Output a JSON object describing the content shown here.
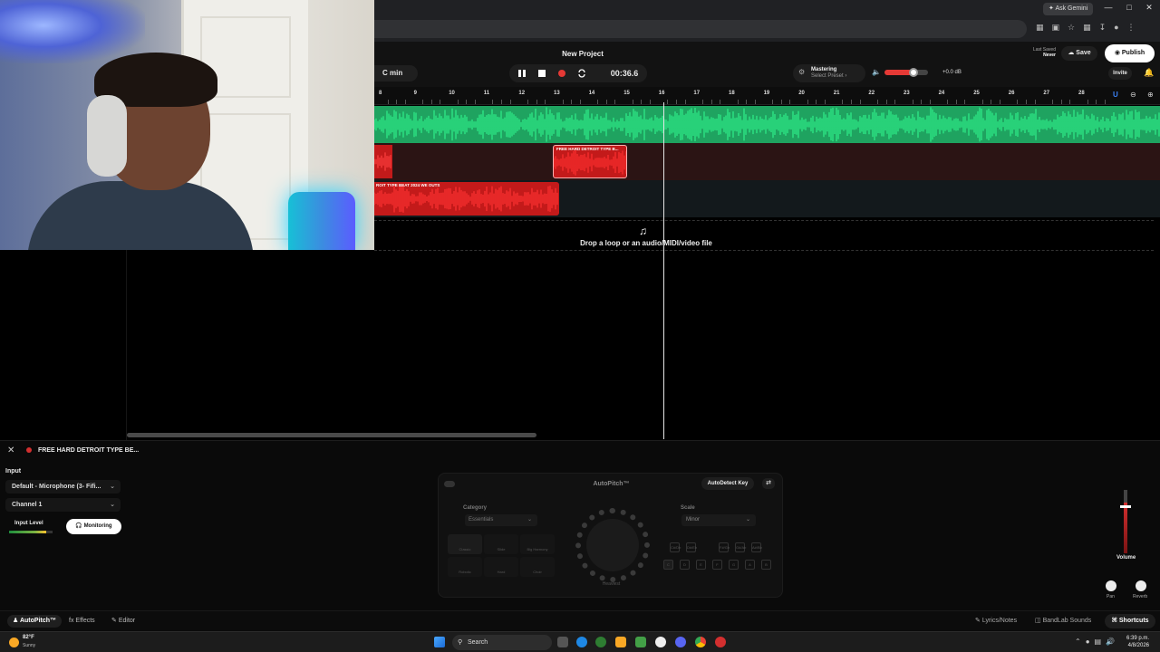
{
  "browser": {
    "ask_gemini": "Ask Gemini",
    "window_controls": [
      "—",
      "□",
      "✕"
    ]
  },
  "daw": {
    "project_title": "New Project",
    "key": "C min",
    "time": "00:36.6",
    "mastering_title": "Mastering",
    "mastering_preset": "Select Preset ›",
    "master_volume": 0.68,
    "volume_db": "+0.0 dB",
    "last_saved_label": "Last Saved",
    "last_saved_value": "Never",
    "save_label": "Save",
    "publish_label": "Publish",
    "invite_label": "Invite",
    "ruler_ticks": [
      "8",
      "9",
      "10",
      "11",
      "12",
      "13",
      "14",
      "15",
      "16",
      "17",
      "18",
      "19",
      "20",
      "21",
      "22",
      "23",
      "24",
      "25",
      "26",
      "27",
      "28"
    ],
    "clip2_label": "FREE HARD DETROIT TYPE B...",
    "clip3_label": "ROIT TYPE BEAT 2024 WE OUTS",
    "drop_text": "Drop a loop or an audio/MIDI/video file",
    "colors": {
      "green_track": "#2ecc71",
      "red_clip": "#c31a1a",
      "accent": "#e53935"
    }
  },
  "editor": {
    "clip_title": "FREE HARD DETROIT TYPE BE...",
    "input_label": "Input",
    "input_device": "Default - Microphone (3- Fifi...",
    "channel": "Channel 1",
    "input_level_label": "Input Level",
    "monitoring_label": "Monitoring",
    "autopitch_title": "AutoPitch™",
    "autodetect_label": "AutoDetect Key",
    "category_label": "Category",
    "category_value": "Essentials",
    "styles": [
      "Classic",
      "Slide",
      "Big Harmony",
      "Robotic",
      "Hard",
      "Choir"
    ],
    "knob_label": "Heaviest",
    "scale_label": "Scale",
    "scale_value": "Minor",
    "sharps": [
      "C#/Db",
      "D#/Eb",
      "F#/Gb",
      "G#/Ab",
      "A#/Bb"
    ],
    "naturals": [
      "C",
      "D",
      "E",
      "F",
      "G",
      "A",
      "B"
    ],
    "volume_label": "Volume",
    "volume_level": 0.72,
    "pan_label": "Pan",
    "reverb_label": "Reverb"
  },
  "tabs": {
    "autopitch": "AutoPitch™",
    "effects": "Effects",
    "editor": "Editor",
    "lyrics": "Lyrics/Notes",
    "sounds": "BandLab Sounds",
    "shortcuts": "Shortcuts"
  },
  "taskbar": {
    "temp": "82°F",
    "condition": "Sunny",
    "search_placeholder": "Search",
    "time": "6:39 p.m.",
    "date": "4/8/2026"
  }
}
